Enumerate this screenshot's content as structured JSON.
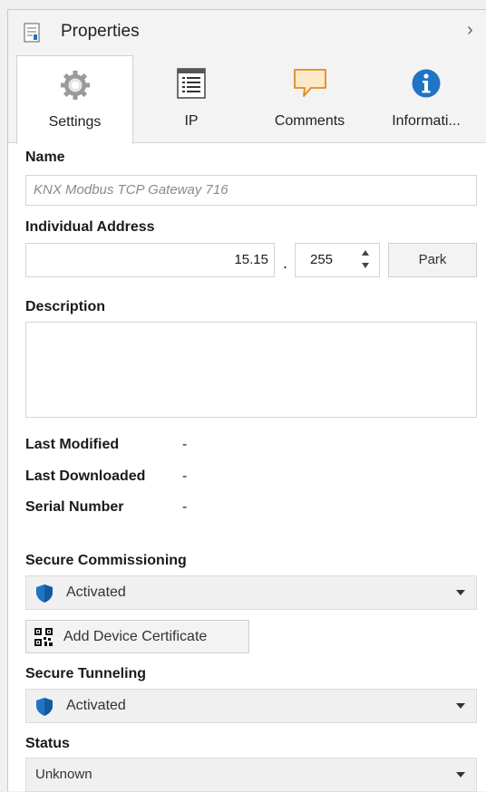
{
  "header": {
    "title": "Properties",
    "collapse_icon": "chevron-right-icon"
  },
  "tabs": [
    {
      "label": "Settings",
      "icon": "gear-icon",
      "active": true
    },
    {
      "label": "IP",
      "icon": "list-window-icon",
      "active": false
    },
    {
      "label": "Comments",
      "icon": "comment-icon",
      "active": false
    },
    {
      "label": "Informati...",
      "icon": "info-icon",
      "active": false
    }
  ],
  "name": {
    "label": "Name",
    "value": "KNX Modbus TCP Gateway 716"
  },
  "address": {
    "label": "Individual Address",
    "prefix": "15.15",
    "separator": ".",
    "device": "255",
    "park_label": "Park"
  },
  "description": {
    "label": "Description",
    "value": ""
  },
  "meta": [
    {
      "label": "Last Modified",
      "value": "-"
    },
    {
      "label": "Last Downloaded",
      "value": "-"
    },
    {
      "label": "Serial Number",
      "value": "-"
    }
  ],
  "secure_commissioning": {
    "label": "Secure Commissioning",
    "value": "Activated",
    "icon": "shield-icon"
  },
  "certificate_button": {
    "label": "Add Device Certificate",
    "icon": "qr-code-icon"
  },
  "secure_tunneling": {
    "label": "Secure Tunneling",
    "value": "Activated",
    "icon": "shield-icon"
  },
  "status": {
    "label": "Status",
    "value": "Unknown"
  },
  "colors": {
    "shield": "#1f74c4",
    "info": "#1f74c4",
    "comment": "#e8a13a",
    "active_tab": "#ffffff"
  }
}
